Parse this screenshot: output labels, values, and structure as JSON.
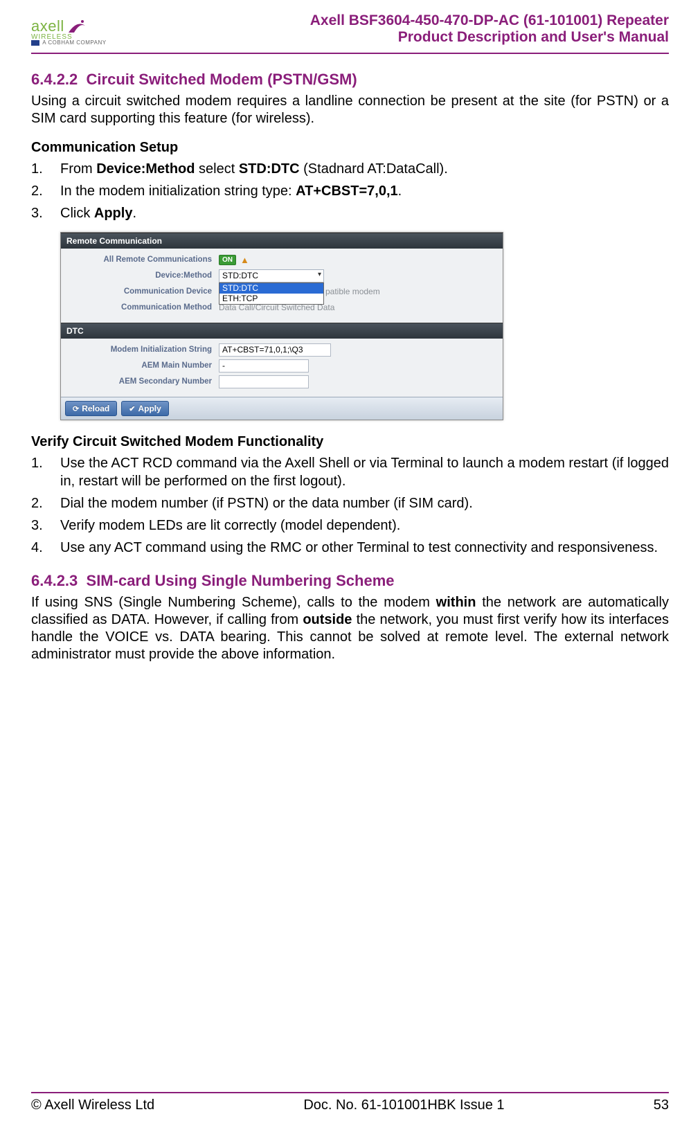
{
  "header": {
    "logo_main": "axell",
    "logo_wireless": "WIRELESS",
    "logo_sub": "A COBHAM COMPANY",
    "title1": "Axell BSF3604-450-470-DP-AC (61-101001) Repeater",
    "title2": "Product Description and User's Manual"
  },
  "section1": {
    "num": "6.4.2.2",
    "title": "Circuit Switched Modem (PSTN/GSM)",
    "intro": "Using a circuit switched modem requires a landline connection be present at the site (for PSTN) or a SIM card supporting this feature (for wireless).",
    "comm_setup_heading": "Communication Setup",
    "steps": [
      {
        "pre": "From ",
        "b1": "Device:Method",
        "mid": " select ",
        "b2": "STD:DTC",
        "post": " (Stadnard AT:DataCall)."
      },
      {
        "pre": "In the modem initialization string type: ",
        "b1": "AT+CBST=7,0,1",
        "post": "."
      },
      {
        "pre": "Click ",
        "b1": "Apply",
        "post": "."
      }
    ]
  },
  "panel": {
    "section1_title": "Remote Communication",
    "rows1": {
      "all_remote": "All Remote Communications",
      "on": "ON",
      "device_method": "Device:Method",
      "device_method_value": "STD:DTC",
      "dropdown_opt1": "STD:DTC",
      "dropdown_opt2": "ETH:TCP",
      "comm_device": "Communication Device",
      "comm_device_value": "patible modem",
      "comm_method": "Communication Method",
      "comm_method_value": "Data Call/Circuit Switched Data"
    },
    "section2_title": "DTC",
    "rows2": {
      "init_string": "Modem Initialization String",
      "init_value": "AT+CBST=71,0,1;\\Q3",
      "aem_main": "AEM Main Number",
      "aem_main_value": "-",
      "aem_secondary": "AEM Secondary Number"
    },
    "buttons": {
      "reload": "Reload",
      "apply": "Apply"
    }
  },
  "verify": {
    "heading": "Verify Circuit Switched Modem Functionality",
    "steps": [
      "Use the ACT RCD command via the Axell Shell or via Terminal to launch a modem restart (if logged in, restart will be performed on the first logout).",
      "Dial the modem number (if PSTN) or the data number (if SIM card).",
      "Verify modem LEDs are lit correctly (model dependent).",
      "Use any ACT command using the RMC or other Terminal to test connectivity and responsiveness."
    ]
  },
  "section2": {
    "num": "6.4.2.3",
    "title": "SIM-card Using Single Numbering Scheme",
    "para_pre": "If using SNS (Single Numbering Scheme), calls to the modem ",
    "b1": "within",
    "para_mid": " the network are automatically classified as DATA. However, if calling from ",
    "b2": "outside",
    "para_post": " the network, you must first verify how its interfaces handle the VOICE vs. DATA bearing. This cannot be solved at remote level. The external network administrator must provide the above information."
  },
  "footer": {
    "left": "© Axell Wireless Ltd",
    "center": "Doc. No. 61-101001HBK Issue 1",
    "right": "53"
  }
}
